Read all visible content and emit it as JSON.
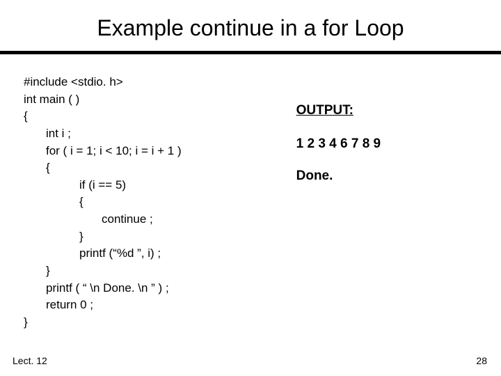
{
  "title": "Example continue in a for Loop",
  "code": {
    "l0": "#include <stdio. h>",
    "l1": "int main ( )",
    "l2": "{",
    "l3": "int i ;",
    "l4": "for ( i = 1; i < 10; i = i + 1 )",
    "l5": "{",
    "l6": "if (i == 5)",
    "l7": "{",
    "l8": "continue ;",
    "l9": "}",
    "l10": "printf (“%d ”, i) ;",
    "l11": "}",
    "l12": "printf ( “ \\n Done. \\n ” ) ;",
    "l13": "return 0 ;",
    "l14": "}"
  },
  "output": {
    "label": "OUTPUT:",
    "line1": "1 2 3 4 6 7 8 9",
    "line2": "Done."
  },
  "footer": {
    "left": "Lect. 12",
    "right": "28"
  }
}
